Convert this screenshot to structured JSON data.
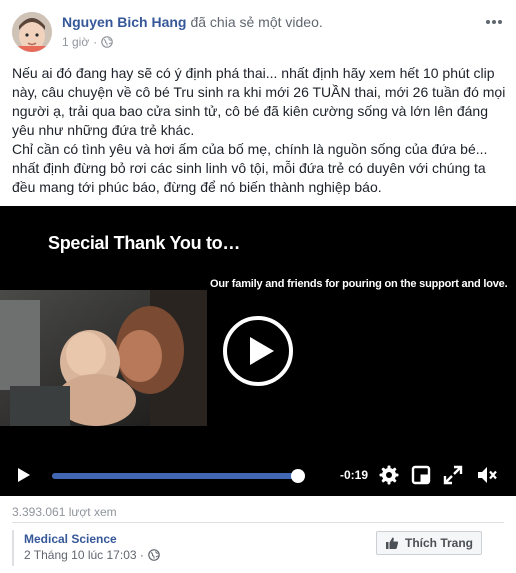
{
  "post": {
    "author": "Nguyen Bich Hang",
    "action": "đã chia sẻ một video.",
    "time": "1 giờ",
    "privacy_icon": "globe-icon",
    "paragraphs": [
      "Nếu ai đó đang hay sẽ có ý định phá thai... nhất định hãy xem hết 10 phút clip này, câu chuyện về cô bé Tru sinh ra khi mới 26 TUẦN thai, mới 26 tuần đó mọi người ạ, trải qua bao cửa sinh tử, cô bé đã kiên cường sống và lớn lên đáng yêu như những đứa trẻ khác.",
      "Chỉ cần có tình yêu và hơi ấm của bố mẹ, chính là nguồn sống của đứa bé... nhất định đừng bỏ rơi các sinh linh vô tội, mỗi đứa trẻ có duyên với chúng ta đều mang tới phúc báo, đừng để nó biến thành nghiệp báo."
    ]
  },
  "video": {
    "title": "Special Thank You to…",
    "caption": "Our family and friends for pouring on the support and love.",
    "time_remaining": "-0:19",
    "progress": 0.99,
    "accent_color": "#4267b2"
  },
  "stats": {
    "views": "3.393.061 lượt xem"
  },
  "page": {
    "name": "Medical Science",
    "date": "2 Tháng 10 lúc 17:03 ·",
    "like_button": "Thích Trang"
  }
}
